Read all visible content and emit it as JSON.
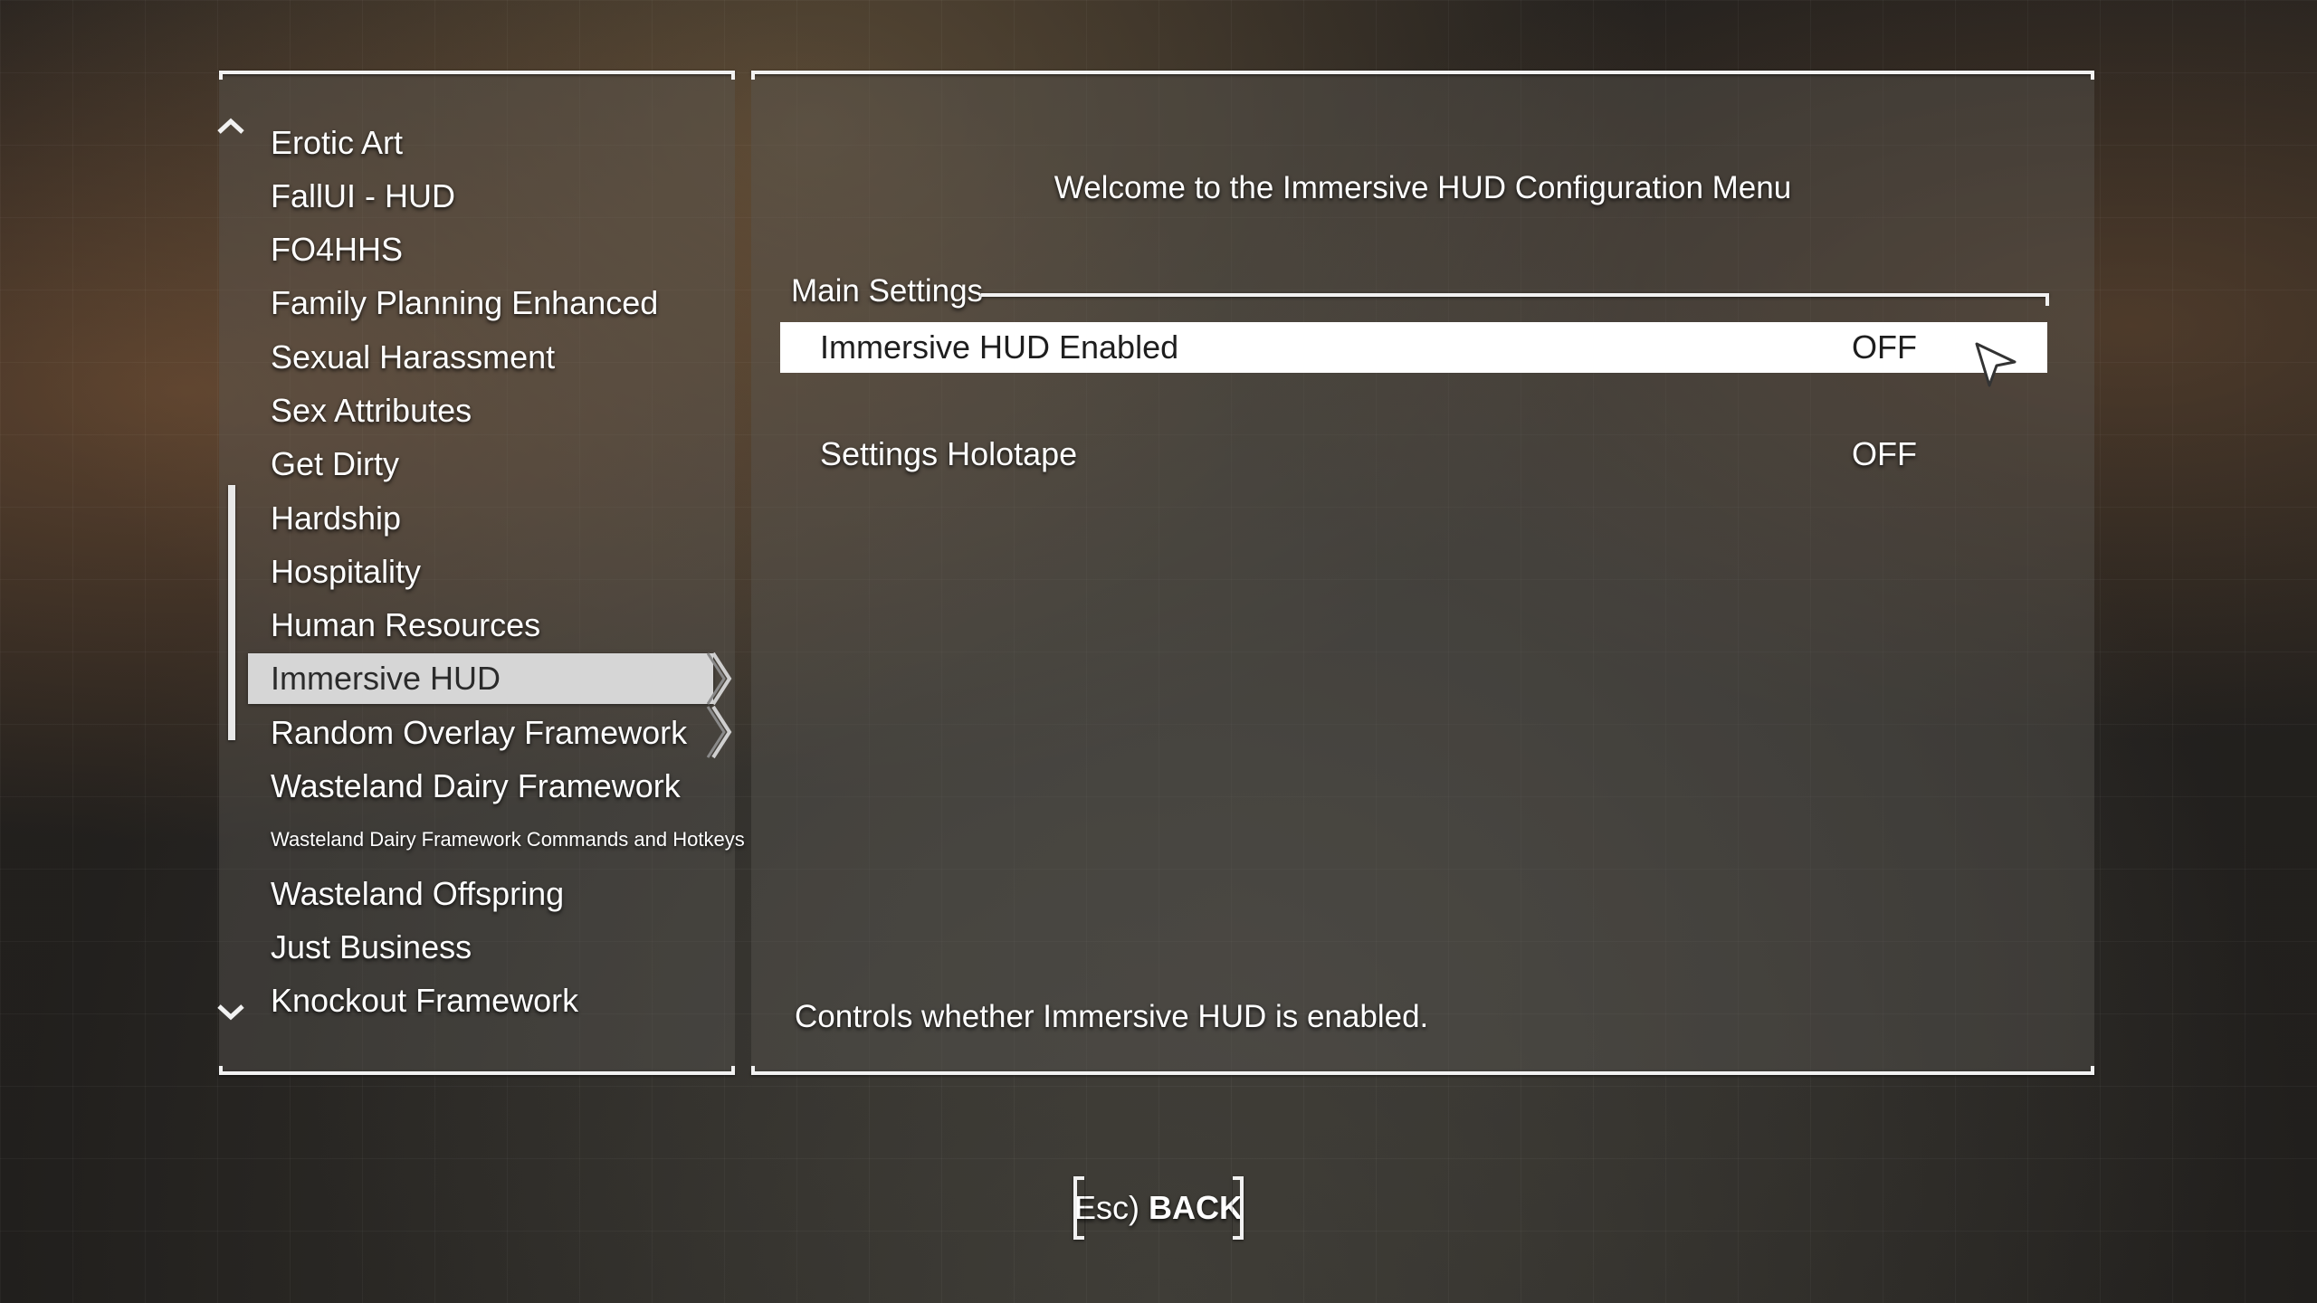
{
  "mod_list": {
    "items": [
      {
        "label": "Erotic Art"
      },
      {
        "label": "FallUI - HUD"
      },
      {
        "label": "FO4HHS"
      },
      {
        "label": "Family Planning Enhanced"
      },
      {
        "label": "Sexual Harassment"
      },
      {
        "label": "Sex Attributes"
      },
      {
        "label": "Get Dirty"
      },
      {
        "label": "Hardship"
      },
      {
        "label": "Hospitality"
      },
      {
        "label": "Human Resources"
      },
      {
        "label": "Immersive HUD"
      },
      {
        "label": "Random Overlay Framework"
      },
      {
        "label": "Wasteland Dairy Framework"
      },
      {
        "label": "Wasteland Dairy Framework Commands and Hotkeys"
      },
      {
        "label": "Wasteland Offspring"
      },
      {
        "label": "Just Business"
      },
      {
        "label": "Knockout Framework"
      }
    ],
    "selected": "Immersive HUD",
    "scroll_up_icon": "chevron-up-icon",
    "scroll_down_icon": "chevron-down-icon"
  },
  "config": {
    "welcome": "Welcome to the Immersive HUD Configuration Menu",
    "section_header": "Main Settings",
    "settings": [
      {
        "label": "Immersive HUD Enabled",
        "value": "OFF"
      },
      {
        "label": "Settings Holotape",
        "value": "OFF"
      }
    ],
    "description": "Controls whether Immersive HUD is enabled."
  },
  "footer": {
    "back_key": "Esc)",
    "back_label": "BACK"
  },
  "colors": {
    "text": "#ffffff",
    "selected_bg": "#ffffff",
    "list_selected_bg": "#d6d6d6",
    "frame": "#f2f2f2"
  }
}
